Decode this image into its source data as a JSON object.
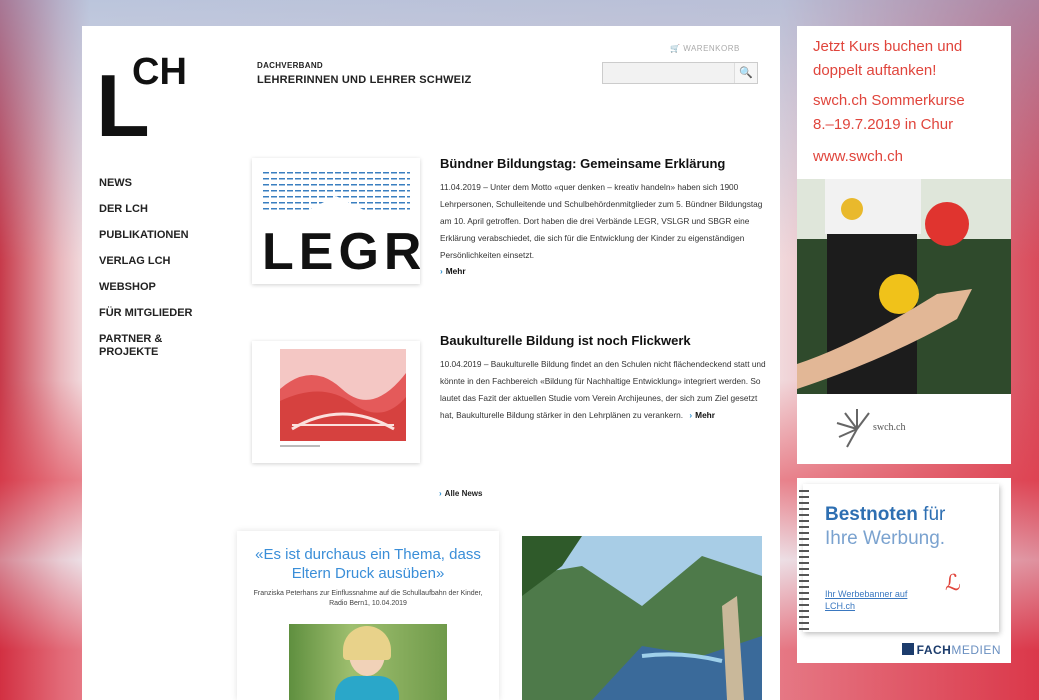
{
  "org": {
    "logo_letter": "L",
    "logo_ch": "CH",
    "subtitle": "DACHVERBAND",
    "title": "LEHRERINNEN UND LEHRER SCHWEIZ"
  },
  "header": {
    "cart_label": "WARENKORB",
    "search_placeholder": "",
    "search_icon": "search-icon"
  },
  "nav": {
    "items": [
      "NEWS",
      "DER LCH",
      "PUBLIKATIONEN",
      "VERLAG LCH",
      "WEBSHOP",
      "FÜR MITGLIEDER",
      "PARTNER &",
      "PROJEKTE"
    ]
  },
  "articles": [
    {
      "title": "Bündner Bildungstag: Gemeinsame Erklärung",
      "body": "11.04.2019 – Unter dem Motto «quer denken – kreativ handeln» haben sich 1900 Lehrpersonen, Schulleitende und Schulbehördenmitglieder zum 5. Bündner Bildungstag am 10. April getroffen. Dort haben die drei Verbände LEGR, VSLGR und SBGR eine Erklärung verabschiedet, die sich für die Entwicklung der Kinder zu eigenständigen Persönlichkeiten einsetzt.",
      "more": "Mehr",
      "thumb_text": "LEGR"
    },
    {
      "title": "Baukulturelle Bildung ist noch Flickwerk",
      "body": "10.04.2019 – Baukulturelle Bildung findet an den Schulen nicht flächendeckend statt und könnte in den Fachbereich «Bildung für Nachhaltige Entwicklung» integriert werden. So lautet das Fazit der aktuellen Studie vom Verein Archijeunes, der sich zum Ziel gesetzt hat, Baukulturelle Bildung stärker in den Lehrplänen zu verankern.",
      "more": "Mehr"
    }
  ],
  "all_news": "Alle News",
  "quote": {
    "text": "«Es ist durchaus ein Thema, dass Eltern Druck ausüben»",
    "source": "Franziska Peterhans zur Einflussnahme auf die Schullaufbahn der Kinder, Radio Bern1, 10.04.2019"
  },
  "ad_swch": {
    "lines": [
      "Jetzt Kurs buchen und",
      "doppelt auftanken!",
      "swch.ch Sommerkurse",
      "8.–19.7.2019 in Chur",
      "www.swch.ch"
    ],
    "brand": "swch.ch",
    "colors": {
      "text": "#e0453c"
    }
  },
  "ad_fachmedien": {
    "title_bold": "Bestnoten",
    "title_rest": " für",
    "title_line2": "Ihre Werbung.",
    "link": "Ihr Werbebanner auf LCH.ch",
    "brand_bold": "FACH",
    "brand_lite": "MEDIEN"
  }
}
